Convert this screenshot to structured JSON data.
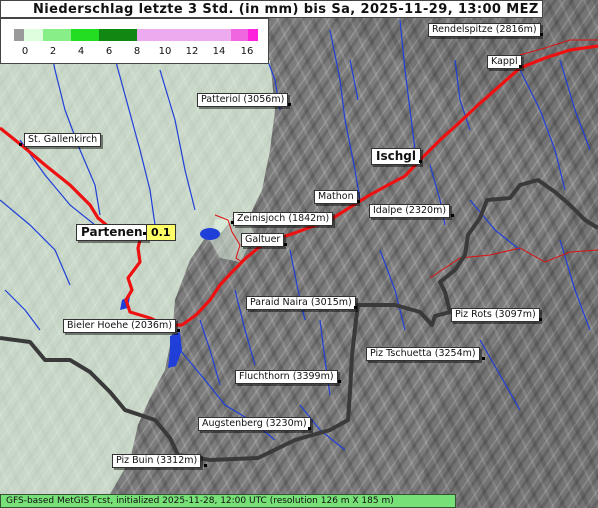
{
  "title": "Niederschlag letzte 3 Std. (in mm) bis Sa, 2025-11-29, 13:00 MEZ",
  "legend": {
    "ticks": [
      "0",
      "2",
      "4",
      "6",
      "8",
      "10",
      "12",
      "14",
      "16"
    ],
    "colors": [
      "#9a9a9a",
      "#ddffdd",
      "#22dd22",
      "#118811",
      "#eeaaee",
      "#ff22dd"
    ]
  },
  "places": [
    {
      "name": "Rendelspitze (2816m)"
    },
    {
      "name": "Kappl"
    },
    {
      "name": "Patteriol (3056m)"
    },
    {
      "name": "St. Gallenkirch"
    },
    {
      "name": "Ischgl"
    },
    {
      "name": "Mathon"
    },
    {
      "name": "Idalpe (2320m)"
    },
    {
      "name": "Zeinisjoch (1842m)"
    },
    {
      "name": "Partenen"
    },
    {
      "name": "Galtuer"
    },
    {
      "name": "Paraid Naira (3015m)"
    },
    {
      "name": "Piz Rots (3097m)"
    },
    {
      "name": "Bieler Hoehe (2036m)"
    },
    {
      "name": "Piz Tschuetta (3254m)"
    },
    {
      "name": "Fluchthorn (3399m)"
    },
    {
      "name": "Augstenberg (3230m)"
    },
    {
      "name": "Piz Buin (3312m)"
    }
  ],
  "precip_value": "0.1",
  "footer": "GFS-based MetGIS Fcst, initialized 2025-11-28, 12:00 UTC  (resolution 126 m X 185 m)"
}
